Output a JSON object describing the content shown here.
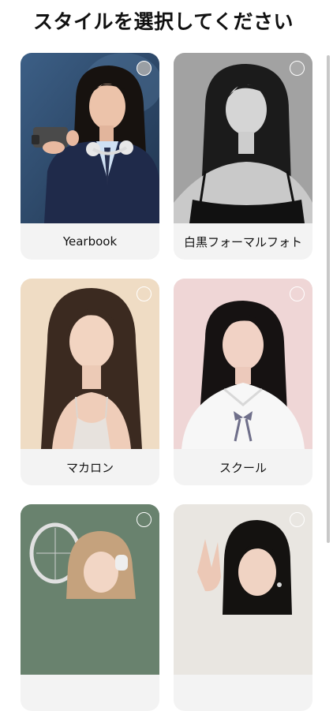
{
  "header": {
    "title": "スタイルを選択してください"
  },
  "styles": [
    {
      "label": "Yearbook"
    },
    {
      "label": "白黒フォーマルフォト"
    },
    {
      "label": "マカロン"
    },
    {
      "label": "スクール"
    },
    {
      "label": ""
    },
    {
      "label": ""
    }
  ]
}
